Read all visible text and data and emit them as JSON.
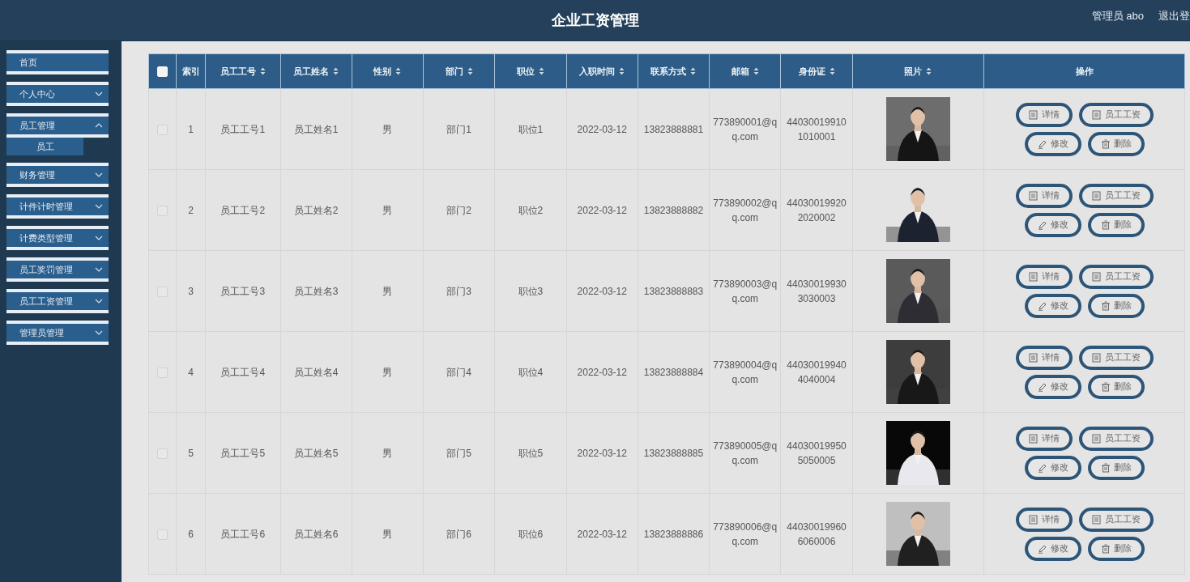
{
  "header": {
    "title": "企业工资管理",
    "user": "管理员 abo",
    "logout": "退出登"
  },
  "sidebar": {
    "items": [
      {
        "label": "首页",
        "kind": "link"
      },
      {
        "label": "个人中心",
        "kind": "menu",
        "expanded": false
      },
      {
        "label": "员工管理",
        "kind": "menu",
        "expanded": true,
        "children": [
          {
            "label": "员工"
          }
        ]
      },
      {
        "label": "财务管理",
        "kind": "menu",
        "expanded": false
      },
      {
        "label": "计件计时管理",
        "kind": "menu",
        "expanded": false
      },
      {
        "label": "计费类型管理",
        "kind": "menu",
        "expanded": false
      },
      {
        "label": "员工奖罚管理",
        "kind": "menu",
        "expanded": false
      },
      {
        "label": "员工工资管理",
        "kind": "menu",
        "expanded": false
      },
      {
        "label": "管理员管理",
        "kind": "menu",
        "expanded": false
      }
    ]
  },
  "table": {
    "select_all": {
      "checked": false
    },
    "columns": [
      {
        "label": "索引",
        "sortable": false
      },
      {
        "label": "员工工号",
        "sortable": true
      },
      {
        "label": "员工姓名",
        "sortable": true
      },
      {
        "label": "性别",
        "sortable": true
      },
      {
        "label": "部门",
        "sortable": true
      },
      {
        "label": "职位",
        "sortable": true
      },
      {
        "label": "入职时间",
        "sortable": true
      },
      {
        "label": "联系方式",
        "sortable": true
      },
      {
        "label": "邮箱",
        "sortable": true
      },
      {
        "label": "身份证",
        "sortable": true
      },
      {
        "label": "照片",
        "sortable": true
      },
      {
        "label": "操作",
        "sortable": false
      }
    ],
    "rows": [
      {
        "checked": false,
        "cells": [
          "1",
          "员工工号1",
          "员工姓名1",
          "男",
          "部门1",
          "职位1",
          "2022-03-12",
          "13823888881",
          "773890001@qq.com",
          "440300199101010001"
        ],
        "actions": [
          "详情",
          "员工工资",
          "修改",
          "删除"
        ]
      },
      {
        "checked": false,
        "cells": [
          "2",
          "员工工号2",
          "员工姓名2",
          "男",
          "部门2",
          "职位2",
          "2022-03-12",
          "13823888882",
          "773890002@qq.com",
          "440300199202020002"
        ],
        "actions": [
          "详情",
          "员工工资",
          "修改",
          "删除"
        ]
      },
      {
        "checked": false,
        "cells": [
          "3",
          "员工工号3",
          "员工姓名3",
          "男",
          "部门3",
          "职位3",
          "2022-03-12",
          "13823888883",
          "773890003@qq.com",
          "440300199303030003"
        ],
        "actions": [
          "详情",
          "员工工资",
          "修改",
          "删除"
        ]
      },
      {
        "checked": false,
        "cells": [
          "4",
          "员工工号4",
          "员工姓名4",
          "男",
          "部门4",
          "职位4",
          "2022-03-12",
          "13823888884",
          "773890004@qq.com",
          "440300199404040004"
        ],
        "actions": [
          "详情",
          "员工工资",
          "修改",
          "删除"
        ]
      },
      {
        "checked": false,
        "cells": [
          "5",
          "员工工号5",
          "员工姓名5",
          "男",
          "部门5",
          "职位5",
          "2022-03-12",
          "13823888885",
          "773890005@qq.com",
          "440300199505050005"
        ],
        "actions": [
          "详情",
          "员工工资",
          "修改",
          "删除"
        ]
      },
      {
        "checked": false,
        "cells": [
          "6",
          "员工工号6",
          "员工姓名6",
          "男",
          "部门6",
          "职位6",
          "2022-03-12",
          "13823888886",
          "773890006@qq.com",
          "440300199606060006"
        ],
        "actions": [
          "详情",
          "员工工资",
          "修改",
          "删除"
        ]
      }
    ]
  }
}
